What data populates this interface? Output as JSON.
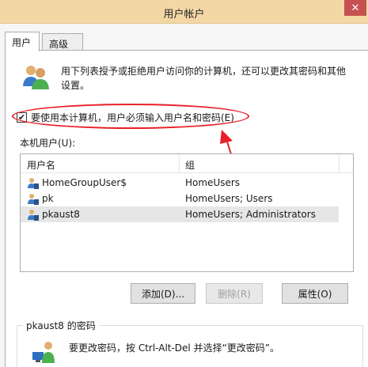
{
  "window": {
    "title": "用户帐户",
    "close_glyph": "✕"
  },
  "tabs": [
    {
      "label": "用户",
      "active": true
    },
    {
      "label": "高级",
      "active": false
    }
  ],
  "intro": {
    "text": "用下列表授予或拒绝用户访问你的计算机，还可以更改其密码和其他设置。"
  },
  "require_login": {
    "label": "要使用本计算机，用户必须输入用户名和密码(E)",
    "checked": true
  },
  "local_users": {
    "label": "本机用户(U):",
    "columns": {
      "name": "用户名",
      "group": "组"
    },
    "rows": [
      {
        "name": "HomeGroupUser$",
        "group": "HomeUsers",
        "selected": false
      },
      {
        "name": "pk",
        "group": "HomeUsers; Users",
        "selected": false
      },
      {
        "name": "pkaust8",
        "group": "HomeUsers; Administrators",
        "selected": true
      }
    ]
  },
  "buttons": {
    "add": "添加(D)...",
    "remove": "删除(R)",
    "properties": "属性(O)"
  },
  "password": {
    "title": "pkaust8 的密码",
    "text": "要更改密码，按 Ctrl-Alt-Del 并选择“更改密码”。"
  },
  "colors": {
    "annotation": "#e8202a",
    "titlebar": "#f3d8a6",
    "close": "#c75050"
  }
}
